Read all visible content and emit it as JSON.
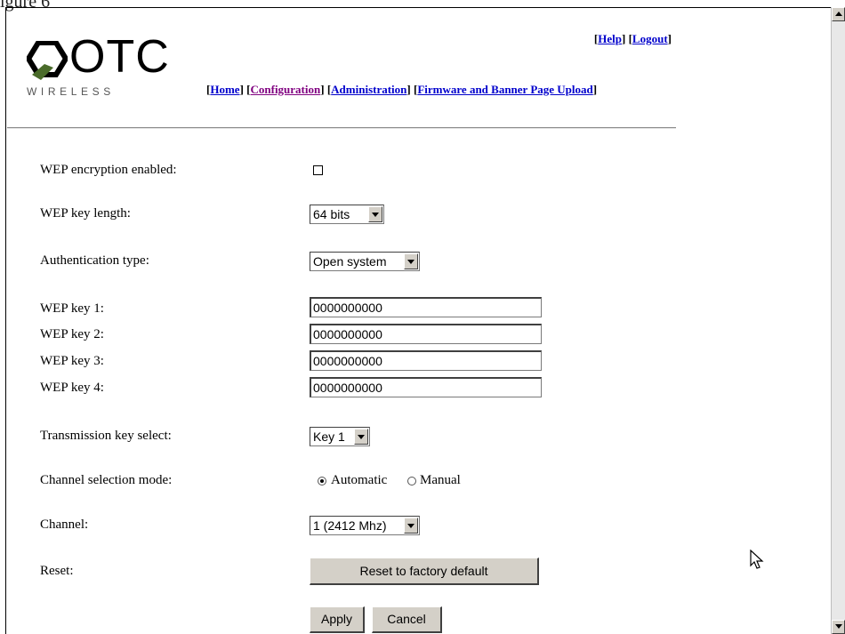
{
  "caption": "igure 6",
  "header": {
    "logo_text": "OTC",
    "logo_sub": "WIRELESS",
    "top_links": [
      "Help",
      "Logout"
    ],
    "nav_links": [
      "Home",
      "Configuration",
      "Administration",
      "Firmware and Banner Page Upload"
    ]
  },
  "form": {
    "wep_enabled": {
      "label": "WEP encryption enabled:",
      "checked": false
    },
    "wep_key_length": {
      "label": "WEP key length:",
      "value": "64 bits"
    },
    "auth_type": {
      "label": "Authentication type:",
      "value": "Open system"
    },
    "wep_keys": [
      {
        "label": "WEP key 1:",
        "value": "0000000000"
      },
      {
        "label": "WEP key 2:",
        "value": "0000000000"
      },
      {
        "label": "WEP key 3:",
        "value": "0000000000"
      },
      {
        "label": "WEP key 4:",
        "value": "0000000000"
      }
    ],
    "tx_key": {
      "label": "Transmission key select:",
      "value": "Key 1"
    },
    "channel_mode": {
      "label": "Channel selection mode:",
      "options": [
        "Automatic",
        "Manual"
      ],
      "selected": "Automatic"
    },
    "channel": {
      "label": "Channel:",
      "value": "1 (2412 Mhz)"
    },
    "reset": {
      "label": "Reset:",
      "button": "Reset to factory default"
    },
    "apply_button": "Apply",
    "cancel_button": "Cancel"
  }
}
